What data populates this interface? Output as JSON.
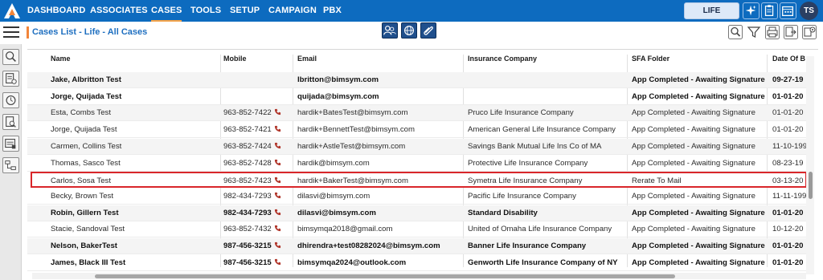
{
  "nav": {
    "items": [
      {
        "label": "DASHBOARD"
      },
      {
        "label": "ASSOCIATES"
      },
      {
        "label": "CASES"
      },
      {
        "label": "TOOLS"
      },
      {
        "label": "SETUP"
      },
      {
        "label": "CAMPAIGN"
      },
      {
        "label": "PBX"
      }
    ],
    "active": "CASES",
    "life_button": "LIFE",
    "avatar_initials": "TS"
  },
  "page": {
    "title": "Cases List - Life - All Cases"
  },
  "table": {
    "columns": [
      "Name",
      "Mobile",
      "Email",
      "Insurance Company",
      "SFA Folder",
      "Date Of B"
    ],
    "rows": [
      {
        "name": "Jake, Albritton Test",
        "mobile": "",
        "email": "lbritton@bimsym.com",
        "company": "",
        "folder": "App Completed - Awaiting Signature",
        "date": "09-27-19",
        "bold": true
      },
      {
        "name": "Jorge, Quijada Test",
        "mobile": "",
        "email": "quijada@bimsym.com",
        "company": "",
        "folder": "App Completed - Awaiting Signature",
        "date": "01-01-20",
        "bold": true
      },
      {
        "name": "Esta, Combs Test",
        "mobile": "963-852-7422",
        "email": "hardik+BatesTest@bimsym.com",
        "company": "Pruco Life Insurance Company",
        "folder": "App Completed - Awaiting Signature",
        "date": "01-01-20",
        "bold": false
      },
      {
        "name": "Jorge, Quijada Test",
        "mobile": "963-852-7421",
        "email": "hardik+BennettTest@bimsym.com",
        "company": "American General Life Insurance Company",
        "folder": "App Completed - Awaiting Signature",
        "date": "01-01-20",
        "bold": false
      },
      {
        "name": "Carmen, Collins Test",
        "mobile": "963-852-7424",
        "email": "hardik+AstleTest@bimsym.com",
        "company": "Savings Bank Mutual Life Ins Co of MA",
        "folder": "App Completed - Awaiting Signature",
        "date": "11-10-199",
        "bold": false
      },
      {
        "name": "Thomas, Sasco Test",
        "mobile": "963-852-7428",
        "email": "hardik@bimsym.com",
        "company": "Protective Life Insurance Company",
        "folder": "App Completed - Awaiting Signature",
        "date": "08-23-19",
        "bold": false
      },
      {
        "name": "Carlos, Sosa Test",
        "mobile": "963-852-7423",
        "email": "hardik+BakerTest@bimsym.com",
        "company": "Symetra Life Insurance Company",
        "folder": "Rerate To Mail",
        "date": "03-13-20",
        "bold": false,
        "selected": true
      },
      {
        "name": "Becky, Brown Test",
        "mobile": "982-434-7293",
        "email": "dilasvi@bimsym.com",
        "company": "Pacific Life Insurance Company",
        "folder": "App Completed - Awaiting Signature",
        "date": "11-11-199",
        "bold": false
      },
      {
        "name": "Robin, Gillern Test",
        "mobile": "982-434-7293",
        "email": "dilasvi@bimsym.com",
        "company": "Standard Disability",
        "folder": "App Completed - Awaiting Signature",
        "date": "01-01-20",
        "bold": true
      },
      {
        "name": "Stacie, Sandoval Test",
        "mobile": "963-852-7432",
        "email": "bimsymqa2018@gmail.com",
        "company": "United of Omaha Life Insurance Company",
        "folder": "App Completed - Awaiting Signature",
        "date": "10-12-20",
        "bold": false
      },
      {
        "name": "Nelson, BakerTest",
        "mobile": "987-456-3215",
        "email": "dhirendra+test08282024@bimsym.com",
        "company": "Banner Life Insurance Company",
        "folder": "App Completed - Awaiting Signature",
        "date": "01-01-20",
        "bold": true
      },
      {
        "name": "James, Black III Test",
        "mobile": "987-456-3215",
        "email": "bimsymqa2024@outlook.com",
        "company": "Genworth Life Insurance Company of NY",
        "folder": "App Completed - Awaiting Signature",
        "date": "01-01-20",
        "bold": true
      }
    ]
  },
  "colors": {
    "nav_bg": "#0d6bbf",
    "accent": "#f2853a",
    "title": "#1e6fc0",
    "selected_border": "#d9262a",
    "phone": "#b0352a"
  }
}
